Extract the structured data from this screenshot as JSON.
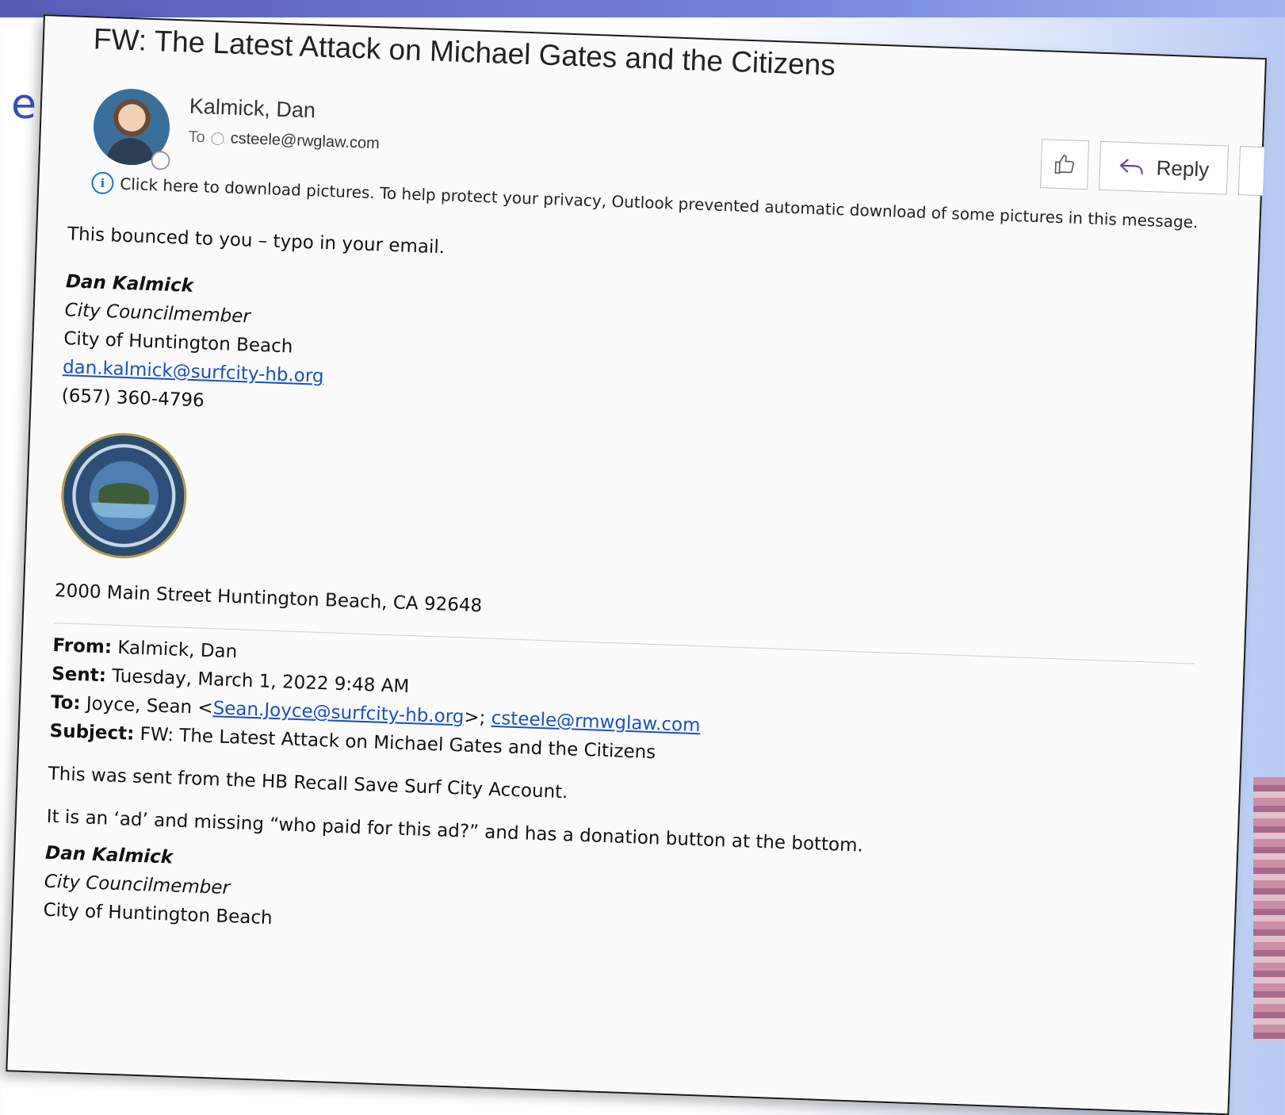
{
  "slide": {
    "partial_letter": "e"
  },
  "email": {
    "subject": "FW: The Latest Attack on Michael Gates and the Citizens",
    "sender_name": "Kalmick, Dan",
    "to_label": "To",
    "to_address": "csteele@rwglaw.com",
    "reply_label": "Reply",
    "info_bar_text": "Click here to download pictures. To help protect your privacy, Outlook prevented automatic download of some pictures in this message.",
    "body_line_1": "This bounced to you – typo in your email.",
    "signature": {
      "name": "Dan Kalmick",
      "title": "City Councilmember",
      "org": "City of Huntington Beach",
      "email": "dan.kalmick@surfcity-hb.org",
      "phone": "(657) 360-4796",
      "address": "2000 Main Street Huntington Beach, CA 92648"
    },
    "forwarded": {
      "from_label": "From:",
      "from_value": "Kalmick, Dan",
      "sent_label": "Sent:",
      "sent_value": "Tuesday, March 1, 2022 9:48 AM",
      "to_label": "To:",
      "to_name": "Joyce, Sean",
      "to_email_1": "Sean.Joyce@surfcity-hb.org",
      "to_email_2": "csteele@rmwglaw.com",
      "subject_label": "Subject:",
      "subject_value": "FW: The Latest Attack on Michael Gates and the Citizens",
      "body_line_1": "This was sent from the HB Recall Save Surf City Account.",
      "body_line_2": "It is an ‘ad’ and missing “who paid for this ad?” and has a donation button at the bottom.",
      "sig_name": "Dan Kalmick",
      "sig_title": "City Councilmember",
      "sig_org": "City of Huntington Beach"
    }
  }
}
